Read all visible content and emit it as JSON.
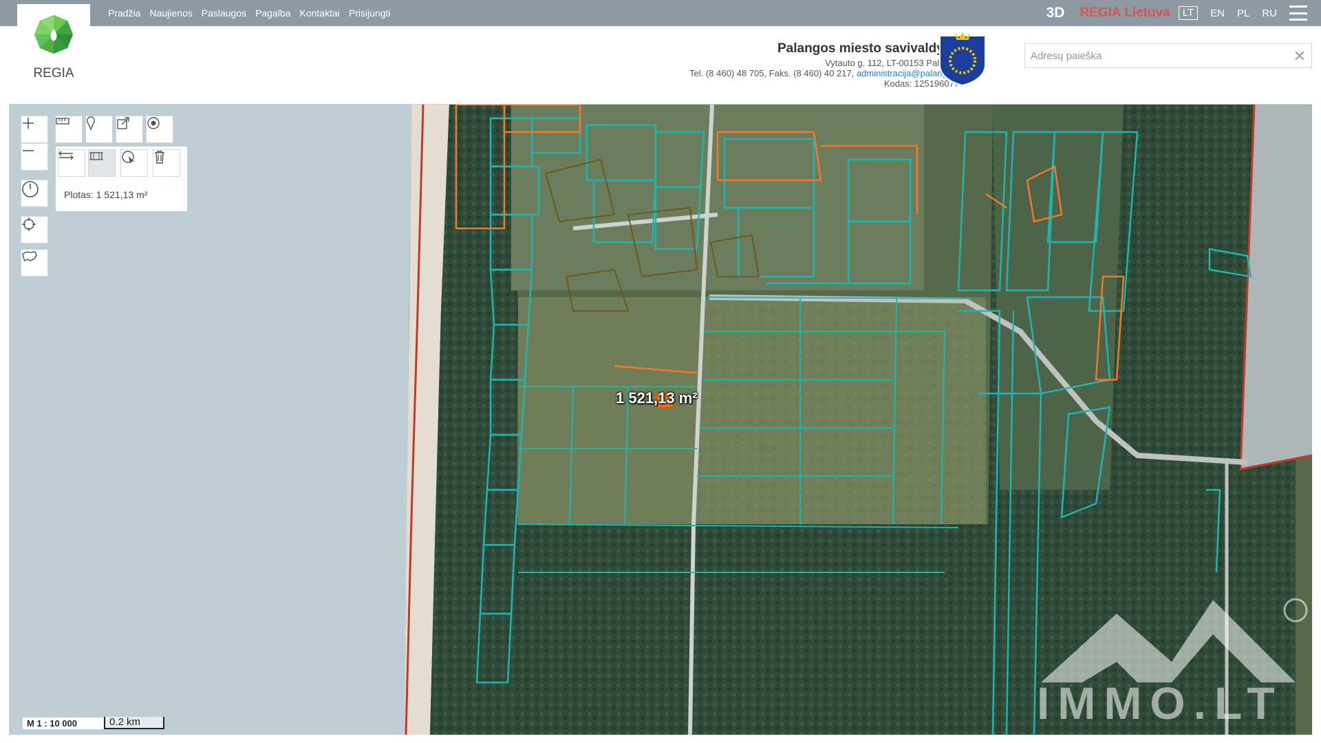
{
  "nav": {
    "items": [
      "Pradžia",
      "Naujienos",
      "Paslaugos",
      "Pagalba",
      "Kontaktai",
      "Prisijungti"
    ]
  },
  "top_right": {
    "btn_3d": "3D",
    "regia_lietuva": "REGIA Lietuva",
    "languages": [
      "LT",
      "EN",
      "PL",
      "RU"
    ],
    "active_language": "LT",
    "menu_icon": "hamburger-icon"
  },
  "logo": {
    "text": "REGIA",
    "icon": "regia-logo-icon"
  },
  "municipality": {
    "name": "Palangos miesto savivaldybė",
    "address": "Vytauto g. 112, LT-00153 Palanga",
    "phone": "Tel. (8 460) 48 705, Faks. (8 460) 40 217,",
    "email": "administracija@palanga.lt",
    "code": "Kodas: 125196077",
    "crest_icon": "coat-of-arms-icon"
  },
  "search": {
    "placeholder": "Adresų paieška",
    "clear_icon": "close-icon"
  },
  "tools": {
    "zoom_in": "plus-icon",
    "zoom_out": "minus-icon",
    "history": "clock-icon",
    "locate": "crosshair-icon",
    "lithuania": "lithuania-map-icon",
    "measure": "ruler-icon",
    "pin": "pin-icon",
    "share": "share-icon",
    "target": "target-icon",
    "measure_distance": "distance-icon",
    "measure_area": "area-icon",
    "identify": "identify-icon",
    "delete": "trash-icon"
  },
  "measure": {
    "result": "Plotas: 1 521,13 m²"
  },
  "map": {
    "area_label": "1 521,13 m²",
    "scale_ratio": "M 1 : 10 000",
    "scale_bar": "0.2 km"
  },
  "watermark": {
    "text": "IMMO.LT",
    "registered": "®"
  },
  "colors": {
    "topbar": "#8d9aa3",
    "sea": "#bfcdd5",
    "parcel_teal": "#1fb5b0",
    "parcel_orange": "#f07a2a",
    "email_link": "#2a7ec0",
    "regia_red": "#d9534f"
  }
}
